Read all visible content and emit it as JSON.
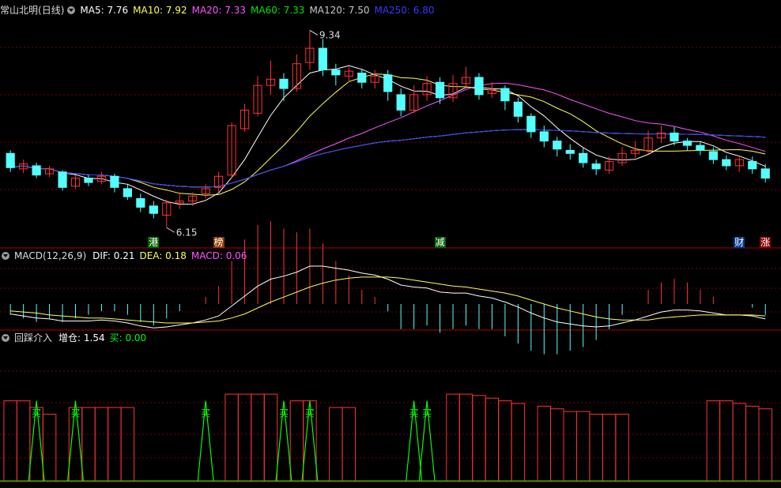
{
  "stock": {
    "name": "常山北明",
    "period": "(日线)"
  },
  "colors": {
    "up": "#ff3232",
    "down": "#54ffff",
    "ma5": "#ffffff",
    "ma10": "#ffff54",
    "ma20": "#ff54ff",
    "ma60": "#00e600",
    "ma120": "#c8c8c8",
    "ma250": "#3838ff",
    "grid": "#7a0000",
    "frame": "#b00000",
    "buy": "#00ff00"
  },
  "ma_legend": [
    {
      "name": "MA5",
      "value": "7.76",
      "color": "#ffffff"
    },
    {
      "name": "MA10",
      "value": "7.92",
      "color": "#ffff54"
    },
    {
      "name": "MA20",
      "value": "7.33",
      "color": "#ff54ff"
    },
    {
      "name": "MA60",
      "value": "7.33",
      "color": "#00e600"
    },
    {
      "name": "MA120",
      "value": "7.50",
      "color": "#c8c8c8"
    },
    {
      "name": "MA250",
      "value": "6.80",
      "color": "#3838ff"
    }
  ],
  "macd_legend": {
    "title": "MACD(12,26,9)",
    "items": [
      {
        "name": "DIF",
        "value": "0.21",
        "color": "#ffffff"
      },
      {
        "name": "DEA",
        "value": "0.18",
        "color": "#ffff54"
      },
      {
        "name": "MACD",
        "value": "0.06",
        "color": "#ff54ff"
      }
    ]
  },
  "ind_legend": {
    "title": "回踩介入",
    "items": [
      {
        "name": "增仓",
        "value": "1.54",
        "color": "#ffffff"
      },
      {
        "name": "买",
        "value": "0.00",
        "color": "#00ff00"
      }
    ]
  },
  "annotations": {
    "high_label": "9.34",
    "low_label": "6.15",
    "buy_label": "买"
  },
  "event_tags": [
    {
      "text": "港",
      "index": 11,
      "color": "#ffffff",
      "bg": "#006400"
    },
    {
      "text": "榜",
      "index": 16,
      "color": "#ffffff",
      "bg": "#8b3a00"
    },
    {
      "text": "减",
      "index": 33,
      "color": "#ffffff",
      "bg": "#006400"
    },
    {
      "text": "财",
      "index": 56,
      "color": "#ffffff",
      "bg": "#003a8b"
    },
    {
      "text": "涨",
      "index": 58,
      "color": "#ffffff",
      "bg": "#8b0000"
    }
  ],
  "chart_data": {
    "type": "candlestick",
    "price_range": [
      6.0,
      9.55
    ],
    "candles": [
      [
        7.35,
        7.12,
        7.4,
        7.05
      ],
      [
        7.1,
        7.18,
        7.25,
        7.03
      ],
      [
        7.15,
        7.0,
        7.2,
        6.95
      ],
      [
        7.02,
        7.1,
        7.15,
        6.97
      ],
      [
        7.05,
        6.8,
        7.08,
        6.75
      ],
      [
        6.82,
        6.95,
        7.0,
        6.78
      ],
      [
        6.95,
        6.88,
        7.0,
        6.82
      ],
      [
        6.9,
        6.98,
        7.05,
        6.85
      ],
      [
        6.98,
        6.8,
        7.02,
        6.72
      ],
      [
        6.78,
        6.65,
        6.85,
        6.6
      ],
      [
        6.62,
        6.48,
        6.7,
        6.4
      ],
      [
        6.5,
        6.38,
        6.58,
        6.3
      ],
      [
        6.35,
        6.55,
        6.6,
        6.15
      ],
      [
        6.55,
        6.58,
        6.7,
        6.45
      ],
      [
        6.58,
        6.66,
        6.72,
        6.5
      ],
      [
        6.7,
        6.78,
        6.85,
        6.62
      ],
      [
        6.8,
        6.98,
        7.05,
        6.72
      ],
      [
        7.0,
        7.8,
        7.85,
        6.95
      ],
      [
        7.75,
        8.05,
        8.15,
        7.7
      ],
      [
        8.0,
        8.45,
        8.6,
        7.95
      ],
      [
        8.45,
        8.55,
        8.85,
        8.3
      ],
      [
        8.55,
        8.4,
        8.65,
        8.2
      ],
      [
        8.4,
        8.8,
        8.95,
        8.35
      ],
      [
        8.82,
        9.05,
        9.34,
        8.7
      ],
      [
        9.05,
        8.7,
        9.2,
        8.6
      ],
      [
        8.7,
        8.62,
        8.8,
        8.45
      ],
      [
        8.6,
        8.68,
        8.75,
        8.5
      ],
      [
        8.65,
        8.5,
        8.72,
        8.4
      ],
      [
        8.5,
        8.6,
        8.7,
        8.4
      ],
      [
        8.62,
        8.35,
        8.7,
        8.2
      ],
      [
        8.3,
        8.05,
        8.4,
        7.95
      ],
      [
        8.05,
        8.3,
        8.45,
        8.0
      ],
      [
        8.3,
        8.48,
        8.6,
        8.2
      ],
      [
        8.5,
        8.25,
        8.58,
        8.15
      ],
      [
        8.25,
        8.48,
        8.62,
        8.18
      ],
      [
        8.48,
        8.58,
        8.75,
        8.4
      ],
      [
        8.58,
        8.3,
        8.65,
        8.22
      ],
      [
        8.32,
        8.38,
        8.5,
        8.25
      ],
      [
        8.4,
        8.2,
        8.45,
        8.05
      ],
      [
        8.18,
        7.95,
        8.25,
        7.85
      ],
      [
        7.95,
        7.7,
        8.0,
        7.6
      ],
      [
        7.7,
        7.55,
        7.8,
        7.45
      ],
      [
        7.55,
        7.42,
        7.62,
        7.3
      ],
      [
        7.4,
        7.35,
        7.5,
        7.25
      ],
      [
        7.35,
        7.2,
        7.45,
        7.12
      ],
      [
        7.18,
        7.1,
        7.25,
        7.0
      ],
      [
        7.08,
        7.22,
        7.3,
        7.02
      ],
      [
        7.2,
        7.35,
        7.45,
        7.15
      ],
      [
        7.35,
        7.4,
        7.55,
        7.28
      ],
      [
        7.4,
        7.6,
        7.72,
        7.35
      ],
      [
        7.6,
        7.68,
        7.8,
        7.52
      ],
      [
        7.68,
        7.55,
        7.78,
        7.48
      ],
      [
        7.55,
        7.48,
        7.6,
        7.4
      ],
      [
        7.48,
        7.4,
        7.55,
        7.32
      ],
      [
        7.38,
        7.25,
        7.45,
        7.18
      ],
      [
        7.25,
        7.15,
        7.32,
        7.08
      ],
      [
        7.15,
        7.25,
        7.32,
        7.05
      ],
      [
        7.22,
        7.1,
        7.3,
        7.02
      ],
      [
        7.1,
        6.95,
        7.18,
        6.88
      ]
    ],
    "macd": {
      "dif": [
        -0.1,
        -0.12,
        -0.14,
        -0.15,
        -0.17,
        -0.17,
        -0.17,
        -0.16,
        -0.17,
        -0.19,
        -0.22,
        -0.24,
        -0.23,
        -0.21,
        -0.19,
        -0.16,
        -0.12,
        -0.02,
        0.08,
        0.18,
        0.25,
        0.28,
        0.32,
        0.38,
        0.38,
        0.36,
        0.34,
        0.31,
        0.29,
        0.25,
        0.19,
        0.17,
        0.16,
        0.12,
        0.11,
        0.11,
        0.08,
        0.06,
        0.02,
        -0.03,
        -0.09,
        -0.14,
        -0.18,
        -0.2,
        -0.22,
        -0.23,
        -0.22,
        -0.19,
        -0.16,
        -0.12,
        -0.08,
        -0.06,
        -0.06,
        -0.07,
        -0.09,
        -0.11,
        -0.11,
        -0.12,
        -0.15
      ],
      "dea": [
        -0.07,
        -0.08,
        -0.09,
        -0.11,
        -0.12,
        -0.13,
        -0.14,
        -0.14,
        -0.15,
        -0.16,
        -0.17,
        -0.18,
        -0.19,
        -0.19,
        -0.19,
        -0.18,
        -0.17,
        -0.14,
        -0.1,
        -0.04,
        0.02,
        0.07,
        0.12,
        0.17,
        0.21,
        0.24,
        0.26,
        0.27,
        0.27,
        0.27,
        0.26,
        0.24,
        0.22,
        0.2,
        0.18,
        0.17,
        0.15,
        0.13,
        0.11,
        0.08,
        0.04,
        0.0,
        -0.04,
        -0.07,
        -0.1,
        -0.13,
        -0.15,
        -0.16,
        -0.16,
        -0.16,
        -0.14,
        -0.13,
        -0.12,
        -0.11,
        -0.11,
        -0.11,
        -0.11,
        -0.11,
        -0.12
      ]
    },
    "ind": {
      "zengcang": [
        0.6,
        0.6,
        0.55,
        0.5,
        0.0,
        0.55,
        0.55,
        0.55,
        0.55,
        0.55,
        0.0,
        0.0,
        0.0,
        0.0,
        0.0,
        0.0,
        0.0,
        0.65,
        0.65,
        0.65,
        0.65,
        0.0,
        0.6,
        0.6,
        0.0,
        0.55,
        0.55,
        0.0,
        0.0,
        0.0,
        0.0,
        0.0,
        0.0,
        0.0,
        0.65,
        0.65,
        0.64,
        0.62,
        0.6,
        0.58,
        0.0,
        0.56,
        0.54,
        0.52,
        0.52,
        0.5,
        0.5,
        0.5,
        0.0,
        0.0,
        0.0,
        0.0,
        0.0,
        0.0,
        0.6,
        0.6,
        0.58,
        0.56,
        0.54
      ],
      "buy": [
        0,
        0,
        1,
        0,
        0,
        1,
        0,
        0,
        0,
        0,
        0,
        0,
        0,
        0,
        0,
        1,
        0,
        0,
        0,
        0,
        0,
        1,
        0,
        1,
        0,
        0,
        0,
        0,
        0,
        0,
        0,
        1,
        1,
        0,
        0,
        0,
        0,
        0,
        0,
        0,
        0,
        0,
        0,
        0,
        0,
        0,
        0,
        0,
        0,
        0,
        0,
        0,
        0,
        0,
        0,
        0,
        0,
        0,
        0
      ]
    }
  }
}
